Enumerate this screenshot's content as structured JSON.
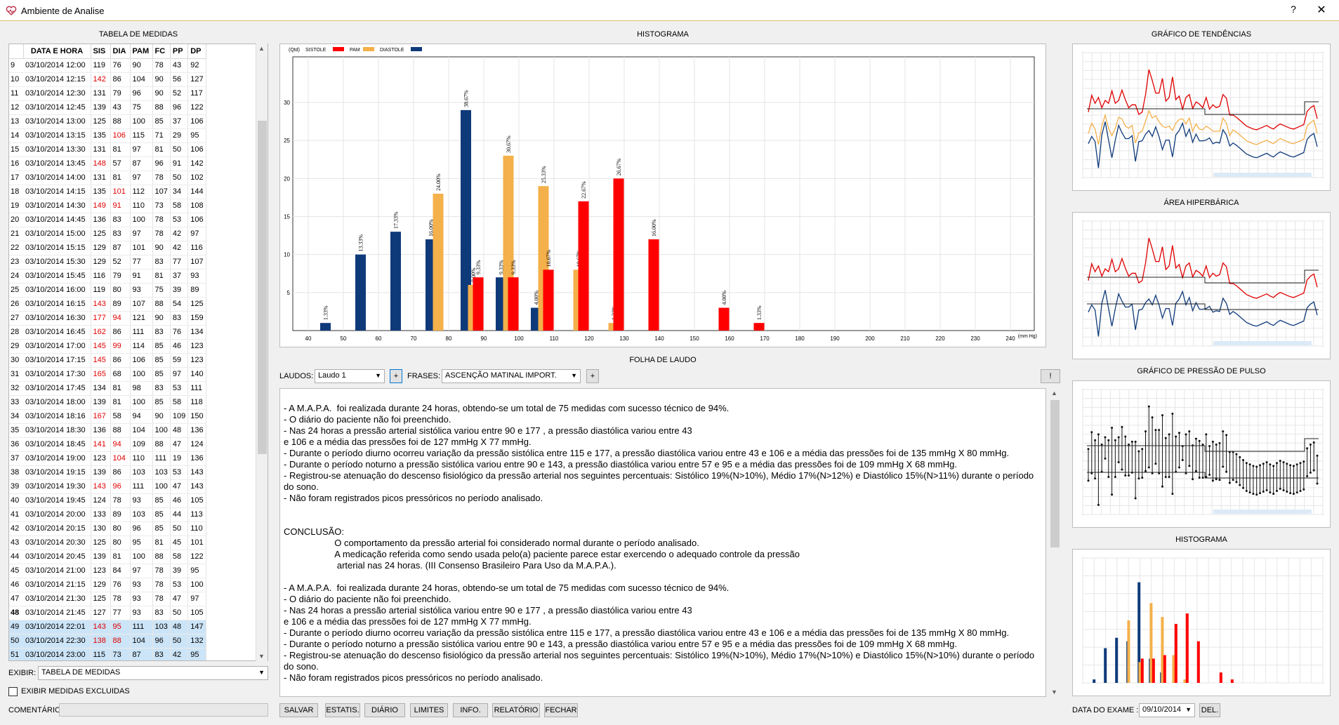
{
  "window": {
    "title": "Ambiente de Analise",
    "help": "?",
    "close": "✕"
  },
  "table_panel": {
    "title": "TABELA DE MEDIDAS",
    "columns": [
      "DATA E HORA",
      "SIS",
      "DIA",
      "PAM",
      "FC",
      "PP",
      "DP"
    ],
    "rows": [
      {
        "n": "9",
        "dt": "03/10/2014 12:00",
        "sis": "119",
        "dia": "76",
        "pam": "90",
        "fc": "78",
        "pp": "43",
        "dp": "92",
        "red": []
      },
      {
        "n": "10",
        "dt": "03/10/2014 12:15",
        "sis": "142",
        "dia": "86",
        "pam": "104",
        "fc": "90",
        "pp": "56",
        "dp": "127",
        "red": [
          "sis"
        ]
      },
      {
        "n": "11",
        "dt": "03/10/2014 12:30",
        "sis": "131",
        "dia": "79",
        "pam": "96",
        "fc": "90",
        "pp": "52",
        "dp": "117",
        "red": []
      },
      {
        "n": "12",
        "dt": "03/10/2014 12:45",
        "sis": "139",
        "dia": "43",
        "pam": "75",
        "fc": "88",
        "pp": "96",
        "dp": "122",
        "red": []
      },
      {
        "n": "13",
        "dt": "03/10/2014 13:00",
        "sis": "125",
        "dia": "88",
        "pam": "100",
        "fc": "85",
        "pp": "37",
        "dp": "106",
        "red": []
      },
      {
        "n": "14",
        "dt": "03/10/2014 13:15",
        "sis": "135",
        "dia": "106",
        "pam": "115",
        "fc": "71",
        "pp": "29",
        "dp": "95",
        "red": [
          "dia"
        ]
      },
      {
        "n": "15",
        "dt": "03/10/2014 13:30",
        "sis": "131",
        "dia": "81",
        "pam": "97",
        "fc": "81",
        "pp": "50",
        "dp": "106",
        "red": []
      },
      {
        "n": "16",
        "dt": "03/10/2014 13:45",
        "sis": "148",
        "dia": "57",
        "pam": "87",
        "fc": "96",
        "pp": "91",
        "dp": "142",
        "red": [
          "sis"
        ]
      },
      {
        "n": "17",
        "dt": "03/10/2014 14:00",
        "sis": "131",
        "dia": "81",
        "pam": "97",
        "fc": "78",
        "pp": "50",
        "dp": "102",
        "red": []
      },
      {
        "n": "18",
        "dt": "03/10/2014 14:15",
        "sis": "135",
        "dia": "101",
        "pam": "112",
        "fc": "107",
        "pp": "34",
        "dp": "144",
        "red": [
          "dia"
        ]
      },
      {
        "n": "19",
        "dt": "03/10/2014 14:30",
        "sis": "149",
        "dia": "91",
        "pam": "110",
        "fc": "73",
        "pp": "58",
        "dp": "108",
        "red": [
          "sis",
          "dia"
        ]
      },
      {
        "n": "20",
        "dt": "03/10/2014 14:45",
        "sis": "136",
        "dia": "83",
        "pam": "100",
        "fc": "78",
        "pp": "53",
        "dp": "106",
        "red": []
      },
      {
        "n": "21",
        "dt": "03/10/2014 15:00",
        "sis": "125",
        "dia": "83",
        "pam": "97",
        "fc": "78",
        "pp": "42",
        "dp": "97",
        "red": []
      },
      {
        "n": "22",
        "dt": "03/10/2014 15:15",
        "sis": "129",
        "dia": "87",
        "pam": "101",
        "fc": "90",
        "pp": "42",
        "dp": "116",
        "red": []
      },
      {
        "n": "23",
        "dt": "03/10/2014 15:30",
        "sis": "129",
        "dia": "52",
        "pam": "77",
        "fc": "83",
        "pp": "77",
        "dp": "107",
        "red": []
      },
      {
        "n": "24",
        "dt": "03/10/2014 15:45",
        "sis": "116",
        "dia": "79",
        "pam": "91",
        "fc": "81",
        "pp": "37",
        "dp": "93",
        "red": []
      },
      {
        "n": "25",
        "dt": "03/10/2014 16:00",
        "sis": "119",
        "dia": "80",
        "pam": "93",
        "fc": "75",
        "pp": "39",
        "dp": "89",
        "red": []
      },
      {
        "n": "26",
        "dt": "03/10/2014 16:15",
        "sis": "143",
        "dia": "89",
        "pam": "107",
        "fc": "88",
        "pp": "54",
        "dp": "125",
        "red": [
          "sis"
        ]
      },
      {
        "n": "27",
        "dt": "03/10/2014 16:30",
        "sis": "177",
        "dia": "94",
        "pam": "121",
        "fc": "90",
        "pp": "83",
        "dp": "159",
        "red": [
          "sis",
          "dia"
        ]
      },
      {
        "n": "28",
        "dt": "03/10/2014 16:45",
        "sis": "162",
        "dia": "86",
        "pam": "111",
        "fc": "83",
        "pp": "76",
        "dp": "134",
        "red": [
          "sis"
        ]
      },
      {
        "n": "29",
        "dt": "03/10/2014 17:00",
        "sis": "145",
        "dia": "99",
        "pam": "114",
        "fc": "85",
        "pp": "46",
        "dp": "123",
        "red": [
          "sis",
          "dia"
        ]
      },
      {
        "n": "30",
        "dt": "03/10/2014 17:15",
        "sis": "145",
        "dia": "86",
        "pam": "106",
        "fc": "85",
        "pp": "59",
        "dp": "123",
        "red": [
          "sis"
        ]
      },
      {
        "n": "31",
        "dt": "03/10/2014 17:30",
        "sis": "165",
        "dia": "68",
        "pam": "100",
        "fc": "85",
        "pp": "97",
        "dp": "140",
        "red": [
          "sis"
        ]
      },
      {
        "n": "32",
        "dt": "03/10/2014 17:45",
        "sis": "134",
        "dia": "81",
        "pam": "98",
        "fc": "83",
        "pp": "53",
        "dp": "111",
        "red": []
      },
      {
        "n": "33",
        "dt": "03/10/2014 18:00",
        "sis": "139",
        "dia": "81",
        "pam": "100",
        "fc": "85",
        "pp": "58",
        "dp": "118",
        "red": []
      },
      {
        "n": "34",
        "dt": "03/10/2014 18:16",
        "sis": "167",
        "dia": "58",
        "pam": "94",
        "fc": "90",
        "pp": "109",
        "dp": "150",
        "red": [
          "sis"
        ]
      },
      {
        "n": "35",
        "dt": "03/10/2014 18:30",
        "sis": "136",
        "dia": "88",
        "pam": "104",
        "fc": "100",
        "pp": "48",
        "dp": "136",
        "red": []
      },
      {
        "n": "36",
        "dt": "03/10/2014 18:45",
        "sis": "141",
        "dia": "94",
        "pam": "109",
        "fc": "88",
        "pp": "47",
        "dp": "124",
        "red": [
          "sis",
          "dia"
        ]
      },
      {
        "n": "37",
        "dt": "03/10/2014 19:00",
        "sis": "123",
        "dia": "104",
        "pam": "110",
        "fc": "111",
        "pp": "19",
        "dp": "136",
        "red": [
          "dia"
        ]
      },
      {
        "n": "38",
        "dt": "03/10/2014 19:15",
        "sis": "139",
        "dia": "86",
        "pam": "103",
        "fc": "103",
        "pp": "53",
        "dp": "143",
        "red": []
      },
      {
        "n": "39",
        "dt": "03/10/2014 19:30",
        "sis": "143",
        "dia": "96",
        "pam": "111",
        "fc": "100",
        "pp": "47",
        "dp": "143",
        "red": [
          "sis",
          "dia"
        ]
      },
      {
        "n": "40",
        "dt": "03/10/2014 19:45",
        "sis": "124",
        "dia": "78",
        "pam": "93",
        "fc": "85",
        "pp": "46",
        "dp": "105",
        "red": []
      },
      {
        "n": "41",
        "dt": "03/10/2014 20:00",
        "sis": "133",
        "dia": "89",
        "pam": "103",
        "fc": "85",
        "pp": "44",
        "dp": "113",
        "red": []
      },
      {
        "n": "42",
        "dt": "03/10/2014 20:15",
        "sis": "130",
        "dia": "80",
        "pam": "96",
        "fc": "85",
        "pp": "50",
        "dp": "110",
        "red": []
      },
      {
        "n": "43",
        "dt": "03/10/2014 20:30",
        "sis": "125",
        "dia": "80",
        "pam": "95",
        "fc": "81",
        "pp": "45",
        "dp": "101",
        "red": []
      },
      {
        "n": "44",
        "dt": "03/10/2014 20:45",
        "sis": "139",
        "dia": "81",
        "pam": "100",
        "fc": "88",
        "pp": "58",
        "dp": "122",
        "red": []
      },
      {
        "n": "45",
        "dt": "03/10/2014 21:00",
        "sis": "123",
        "dia": "84",
        "pam": "97",
        "fc": "78",
        "pp": "39",
        "dp": "95",
        "red": []
      },
      {
        "n": "46",
        "dt": "03/10/2014 21:15",
        "sis": "129",
        "dia": "76",
        "pam": "93",
        "fc": "78",
        "pp": "53",
        "dp": "100",
        "red": []
      },
      {
        "n": "47",
        "dt": "03/10/2014 21:30",
        "sis": "125",
        "dia": "78",
        "pam": "93",
        "fc": "78",
        "pp": "47",
        "dp": "97",
        "red": []
      },
      {
        "n": "48",
        "dt": "03/10/2014 21:45",
        "sis": "127",
        "dia": "77",
        "pam": "93",
        "fc": "83",
        "pp": "50",
        "dp": "105",
        "red": [],
        "current": true
      },
      {
        "n": "49",
        "dt": "03/10/2014 22:01",
        "sis": "143",
        "dia": "95",
        "pam": "111",
        "fc": "103",
        "pp": "48",
        "dp": "147",
        "red": [
          "sis",
          "dia"
        ],
        "selected": true
      },
      {
        "n": "50",
        "dt": "03/10/2014 22:30",
        "sis": "138",
        "dia": "88",
        "pam": "104",
        "fc": "96",
        "pp": "50",
        "dp": "132",
        "red": [
          "sis",
          "dia"
        ],
        "selected": true
      },
      {
        "n": "51",
        "dt": "03/10/2014 23:00",
        "sis": "115",
        "dia": "73",
        "pam": "87",
        "fc": "83",
        "pp": "42",
        "dp": "95",
        "red": [],
        "selected": true
      }
    ],
    "exibir_label": "EXIBIR:",
    "exibir_value": "TABELA DE MEDIDAS",
    "excluded_label": "EXIBIR MEDIDAS EXCLUIDAS",
    "comment_label": "COMENTÁRIO"
  },
  "histogram": {
    "title": "HISTOGRAMA",
    "unit_label": "(Qtd)",
    "x_unit": "(mm Hg)",
    "legend": [
      {
        "name": "SISTOLE",
        "color": "#ff0000"
      },
      {
        "name": "PAM",
        "color": "#f4b04a"
      },
      {
        "name": "DIASTOLE",
        "color": "#0f3a7a"
      }
    ]
  },
  "chart_data": {
    "type": "bar",
    "x_ticks": [
      "40",
      "50",
      "60",
      "70",
      "80",
      "90",
      "100",
      "110",
      "120",
      "130",
      "140",
      "150",
      "160",
      "170",
      "180",
      "190",
      "200",
      "210",
      "220",
      "230",
      "240"
    ],
    "y_ticks": [
      "5",
      "10",
      "15",
      "20",
      "25",
      "30"
    ],
    "ylim": [
      0,
      36
    ],
    "xlim": [
      40,
      250
    ],
    "series": [
      {
        "name": "DIASTOLE",
        "color": "#0f3a7a",
        "points": [
          {
            "x": 50,
            "y": 1,
            "label": "1.33%"
          },
          {
            "x": 60,
            "y": 10,
            "label": "13.33%"
          },
          {
            "x": 70,
            "y": 13,
            "label": "17.33%"
          },
          {
            "x": 80,
            "y": 12,
            "label": "16.00%"
          },
          {
            "x": 90,
            "y": 29,
            "label": "38.67%"
          },
          {
            "x": 100,
            "y": 7,
            "label": "9.33%"
          },
          {
            "x": 110,
            "y": 3,
            "label": "4.00%"
          }
        ]
      },
      {
        "name": "PAM",
        "color": "#f4b04a",
        "points": [
          {
            "x": 80,
            "y": 18,
            "label": "24.00%"
          },
          {
            "x": 90,
            "y": 6,
            "label": "8.00%"
          },
          {
            "x": 100,
            "y": 23,
            "label": "30.67%"
          },
          {
            "x": 110,
            "y": 19,
            "label": "25.33%"
          },
          {
            "x": 120,
            "y": 8,
            "label": "10.67%"
          },
          {
            "x": 130,
            "y": 1,
            "label": "1.33%"
          }
        ]
      },
      {
        "name": "SISTOLE",
        "color": "#ff0000",
        "points": [
          {
            "x": 90,
            "y": 7,
            "label": "9.33%"
          },
          {
            "x": 100,
            "y": 7,
            "label": "9.33%"
          },
          {
            "x": 110,
            "y": 8,
            "label": "10.67%"
          },
          {
            "x": 120,
            "y": 17,
            "label": "22.67%"
          },
          {
            "x": 130,
            "y": 20,
            "label": "26.67%"
          },
          {
            "x": 140,
            "y": 12,
            "label": "16.00%"
          },
          {
            "x": 160,
            "y": 3,
            "label": "4.00%"
          },
          {
            "x": 170,
            "y": 1,
            "label": "1.33%"
          }
        ]
      }
    ]
  },
  "laudo": {
    "title": "FOLHA DE LAUDO",
    "laudos_label": "LAUDOS:",
    "laudos_value": "Laudo 1",
    "frases_label": "FRASES:",
    "frases_value": "ASCENÇÃO MATINAL IMPORT.",
    "plus": "+",
    "alert": "!",
    "text": "- A M.A.P.A.  foi realizada durante 24 horas, obtendo-se um total de 75 medidas com sucesso técnico de 94%.\n- O diário do paciente não foi preenchido.\n- Nas 24 horas a pressão arterial sistólica variou entre 90 e 177 , a pressão diastólica variou entre 43\ne 106 e a média das pressões foi de 127 mmHg X 77 mmHg.\n- Durante o período diurno ocorreu variação da pressão sistólica entre 115 e 177, a pressão diastólica variou entre 43 e 106 e a média das pressões foi de 135 mmHg X 80 mmHg.\n- Durante o período noturno a pressão sistólica variou entre 90 e 143, a pressão diastólica variou entre 57 e 95 e a média das pressões foi de 109 mmHg X 68 mmHg.\n- Registrou-se atenuação do descenso fisiológico da pressão arterial nos seguintes percentuais: Sistólico 19%(N>10%), Médio 17%(N>12%) e Diastólico 15%(N>11%) durante o período do sono.\n- Não foram registrados picos pressóricos no período analisado.\n\n\nCONCLUSÃO:\n                    O comportamento da pressão arterial foi considerado normal durante o período analisado.\n                    A medicação referida como sendo usada pelo(a) paciente parece estar exercendo o adequado controle da pressão\n                     arterial nas 24 horas. (III Consenso Brasileiro Para Uso da M.A.P.A.).\n\n- A M.A.P.A.  foi realizada durante 24 horas, obtendo-se um total de 75 medidas com sucesso técnico de 94%.\n- O diário do paciente não foi preenchido.\n- Nas 24 horas a pressão arterial sistólica variou entre 90 e 177 , a pressão diastólica variou entre 43\ne 106 e a média das pressões foi de 127 mmHg X 77 mmHg.\n- Durante o período diurno ocorreu variação da pressão sistólica entre 115 e 177, a pressão diastólica variou entre 43 e 106 e a média das pressões foi de 135 mmHg X 80 mmHg.\n- Durante o período noturno a pressão sistólica variou entre 90 e 143, a pressão diastólica variou entre 57 e 95 e a média das pressões foi de 109 mmHg X 68 mmHg.\n- Registrou-se atenuação do descenso fisiológico da pressão arterial nos seguintes percentuais: Sistólico 19%(N>10%), Médio 17%(N>10%) e Diastólico 15%(N>10%) durante o período do sono.\n- Não foram registrados picos pressóricos no período analisado."
  },
  "buttons": [
    "SALVAR",
    "ESTATIS.",
    "DIÁRIO",
    "LIMITES",
    "INFO.",
    "RELATÓRIO",
    "FECHAR"
  ],
  "right_panel": {
    "trend_title": "GRÁFICO DE TENDÊNCIAS",
    "area_title": "ÁREA HIPERBÁRICA",
    "pulse_title": "GRÁFICO DE PRESSÃO DE PULSO",
    "hist_title": "HISTOGRAMA",
    "exam_date_label": "DATA DO EXAME :",
    "exam_date_value": "09/10/2014",
    "del_label": "DEL."
  }
}
